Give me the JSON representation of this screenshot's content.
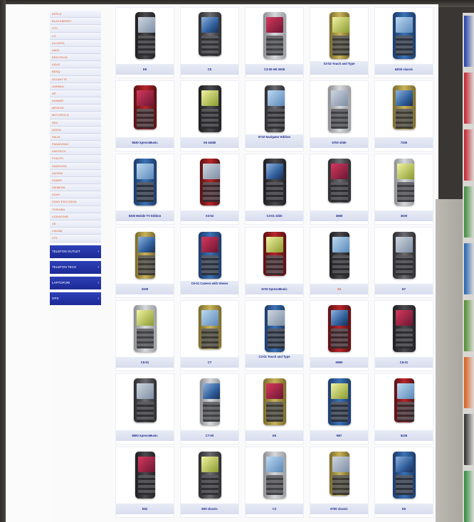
{
  "sidebar": {
    "brands": [
      "Apple",
      "Blackberry",
      "HTC",
      "LG",
      "Alcatel",
      "Amoi",
      "Ericsson",
      "Asus",
      "BenQ",
      "Gigabyte",
      "Garmin",
      "HP",
      "Huawei",
      "Medion",
      "Motorola",
      "NEC",
      "Nokia",
      "Palm",
      "Panasonic",
      "Pantech",
      "Philips",
      "Samsung",
      "Sagem",
      "Sharp",
      "Siemens",
      "Sony",
      "Sony Ericsson",
      "Toshiba",
      "Vodafone",
      "VK",
      "Xiaomi",
      "ZTE"
    ],
    "categories": [
      {
        "label": "Telefon outlet",
        "arrow": "›"
      },
      {
        "label": "Telefon Tech",
        "arrow": "›"
      },
      {
        "label": "Laptopuri",
        "arrow": "›"
      },
      {
        "label": "GPS",
        "arrow": "›"
      }
    ]
  },
  "products": [
    [
      "E5",
      "C5",
      "C3-00 HD 2008",
      "X3-02 Touch and Type",
      "6303i classic"
    ],
    [
      "5530 XpressMusic",
      "X6 16GB",
      "6710 Navigator Edition",
      "6700 slide",
      "7230"
    ],
    [
      "5330 Mobile TV Edition",
      "X3-02",
      "C3-01 slide",
      "2680",
      "2630"
    ],
    [
      "2330",
      "C6-01 Camera with Stereo",
      "5730 XpressMusic",
      "X2",
      "E7"
    ],
    [
      "C6-01",
      "C7",
      "C3-01 Touch and Type",
      "N900",
      "C6-01"
    ],
    [
      "5800 XpressMusic",
      "C7-00",
      "E5",
      "N97",
      "5235"
    ],
    [
      "E52",
      "E90 classic",
      "C2",
      "6700 classic",
      "E6"
    ]
  ],
  "colors": {
    "accent_blue": "#1f2e9e",
    "brand_orange": "#e05a24",
    "label_bg": "#dde2f0"
  }
}
